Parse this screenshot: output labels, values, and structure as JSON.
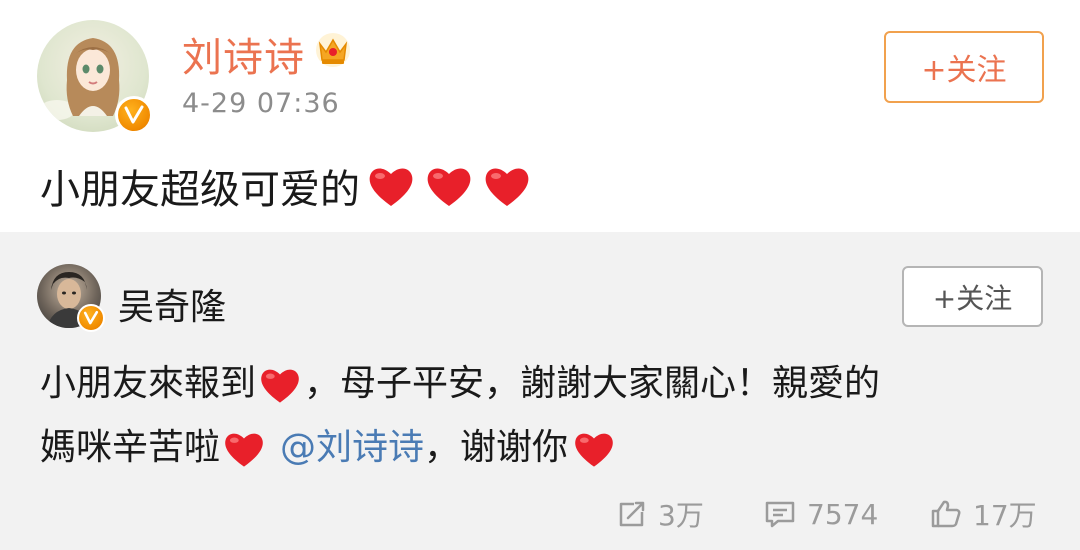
{
  "post": {
    "author": "刘诗诗",
    "time": "4-29 07:36",
    "follow_label": "+关注",
    "text": "小朋友超级可爱的",
    "heart_count": 3
  },
  "repost": {
    "author": "吴奇隆",
    "follow_label": "+关注",
    "text_part1": "小朋友來報到",
    "text_part2": "，母子平安，謝謝大家關心！親愛的",
    "text_part3": "媽咪辛苦啦",
    "mention": "@刘诗诗",
    "text_part4": "，谢谢你",
    "actions": {
      "repost_count": "3万",
      "comment_count": "7574",
      "like_count": "17万"
    }
  },
  "colors": {
    "accent": "#eb7350",
    "mention": "#4a7bb4",
    "heart": "#e8202a",
    "repost_bg": "#f2f2f2"
  },
  "icons": [
    "verified-v-icon",
    "crown-icon",
    "heart-icon",
    "repost-icon",
    "comment-icon",
    "like-icon"
  ]
}
